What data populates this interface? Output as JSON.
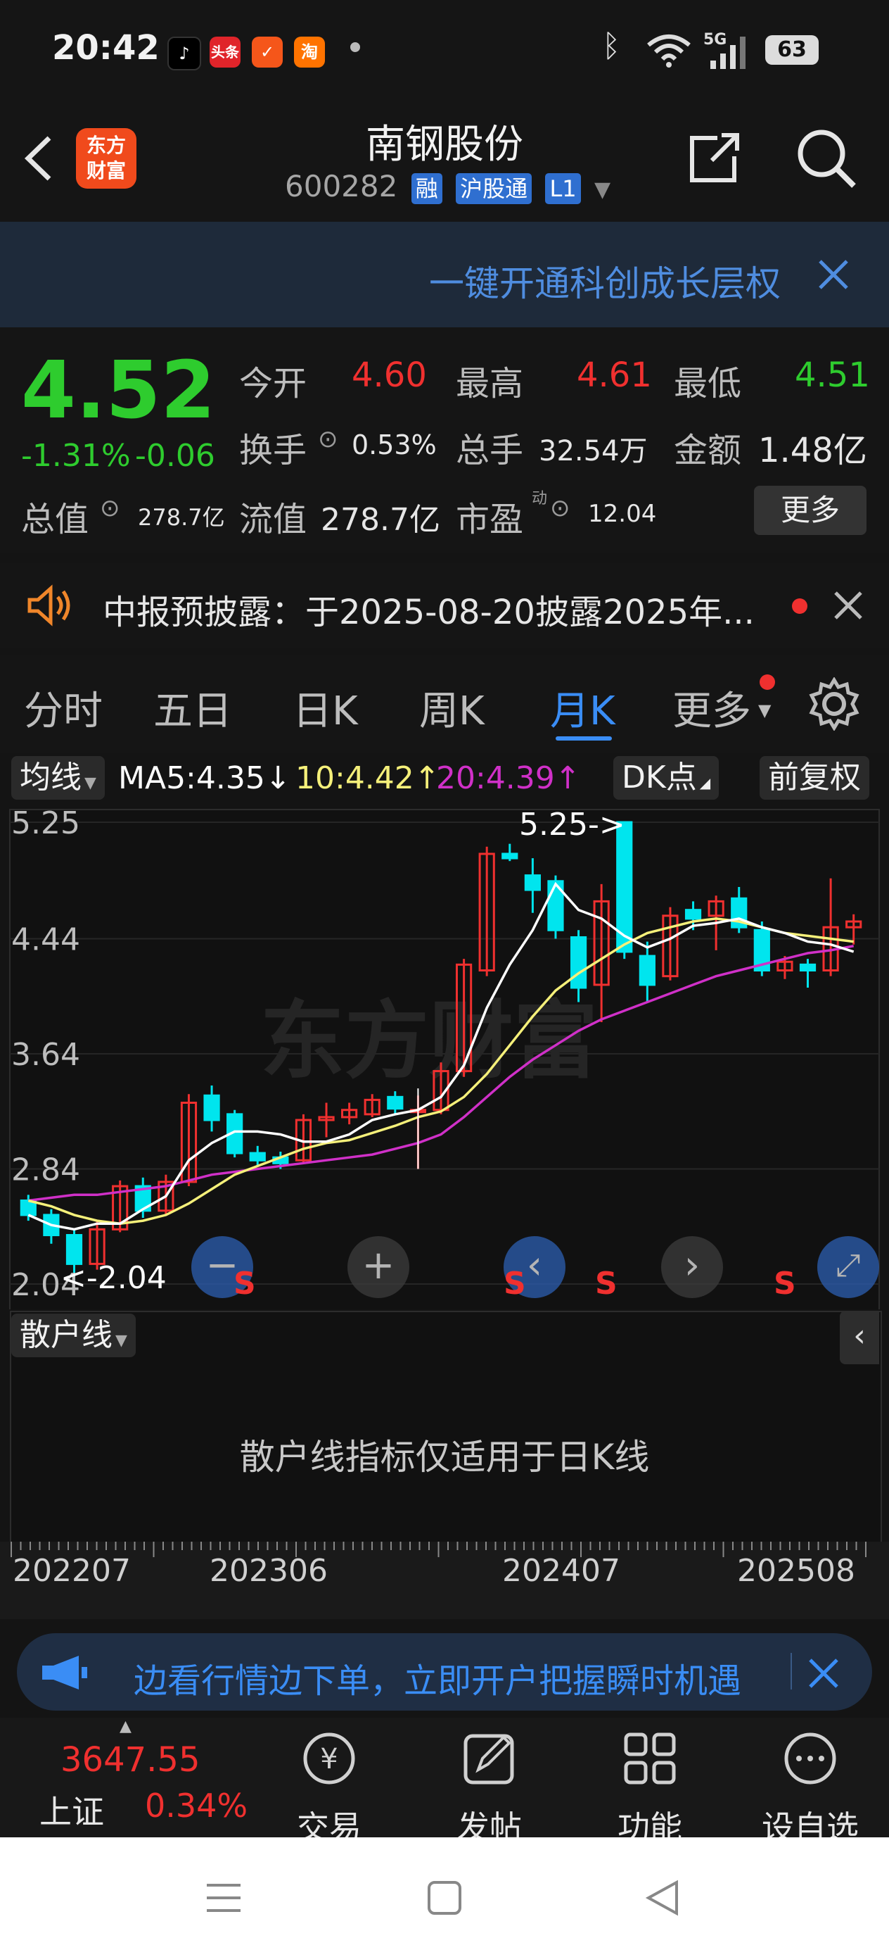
{
  "status_bar": {
    "time": "20:42",
    "battery": "63",
    "network": "5G",
    "app_icons": [
      "tiktok-icon",
      "toutiao-icon",
      "app-icon",
      "taobao-icon"
    ],
    "toutiao_label": "头条",
    "taobao_label": "淘"
  },
  "header": {
    "title": "南钢股份",
    "code": "600282",
    "tags": [
      "融",
      "沪股通",
      "L1"
    ],
    "logo_line1": "东方",
    "logo_line2": "财富"
  },
  "banner": {
    "text": "一键开通科创成长层权"
  },
  "quote": {
    "price": "4.52",
    "change_pct": "-1.31%",
    "change": "-0.06",
    "open_label": "今开",
    "open": "4.60",
    "high_label": "最高",
    "high": "4.61",
    "low_label": "最低",
    "low": "4.51",
    "turnover_label": "换手",
    "turnover": "0.53%",
    "volume_label": "总手",
    "volume": "32.54万",
    "amount_label": "金额",
    "amount": "1.48亿",
    "mktcap_label": "总值",
    "mktcap": "278.7亿",
    "float_label": "流值",
    "float": "278.7亿",
    "pe_label": "市盈",
    "pe_sup": "动",
    "pe": "12.04",
    "more_button": "更多"
  },
  "notice": {
    "text": "中报预披露：于2025-08-20披露2025年..."
  },
  "tabs": [
    "分时",
    "五日",
    "日K",
    "周K",
    "月K",
    "更多"
  ],
  "chart": {
    "ma_select": "均线",
    "ma5": "MA5:4.35↓",
    "ma10": "10:4.42↑",
    "ma20": "20:4.39↑",
    "dk_button": "DK点",
    "adjust_button": "前复权",
    "y_labels": [
      "5.25",
      "4.44",
      "3.64",
      "2.84",
      "2.04"
    ],
    "max_label": "5.25->",
    "min_label": "<-2.04",
    "signal_label": "S",
    "indicator_select": "散户线",
    "indicator_note": "散户线指标仅适用于日K线",
    "x_labels": [
      "202207",
      "202306",
      "202407",
      "202508"
    ],
    "colors": {
      "up": "#f0302f",
      "down": "#00e5ee",
      "ma5": "#ffffff",
      "ma10": "#f5f07a",
      "ma20": "#d030c8"
    }
  },
  "chart_data": {
    "type": "candlestick",
    "period": "monthly",
    "y_ticks": [
      5.25,
      4.44,
      3.64,
      2.84,
      2.04
    ],
    "ylim": [
      2.04,
      5.25
    ],
    "x_ticks": [
      "202207",
      "202306",
      "202407",
      "202508"
    ],
    "candles": [
      {
        "o": 2.62,
        "c": 2.52,
        "h": 2.66,
        "l": 2.48
      },
      {
        "o": 2.52,
        "c": 2.38,
        "h": 2.56,
        "l": 2.32
      },
      {
        "o": 2.38,
        "c": 2.18,
        "h": 2.42,
        "l": 2.04
      },
      {
        "o": 2.18,
        "c": 2.42,
        "h": 2.48,
        "l": 2.14
      },
      {
        "o": 2.42,
        "c": 2.72,
        "h": 2.76,
        "l": 2.4
      },
      {
        "o": 2.72,
        "c": 2.55,
        "h": 2.78,
        "l": 2.5
      },
      {
        "o": 2.55,
        "c": 2.75,
        "h": 2.8,
        "l": 2.52
      },
      {
        "o": 2.75,
        "c": 3.3,
        "h": 3.36,
        "l": 2.72
      },
      {
        "o": 3.35,
        "c": 3.18,
        "h": 3.42,
        "l": 3.1
      },
      {
        "o": 3.22,
        "c": 2.95,
        "h": 3.25,
        "l": 2.92
      },
      {
        "o": 2.95,
        "c": 2.9,
        "h": 3.0,
        "l": 2.86
      },
      {
        "o": 2.92,
        "c": 2.88,
        "h": 2.96,
        "l": 2.84
      },
      {
        "o": 2.9,
        "c": 3.18,
        "h": 3.22,
        "l": 2.88
      },
      {
        "o": 3.18,
        "c": 3.2,
        "h": 3.3,
        "l": 3.06
      },
      {
        "o": 3.2,
        "c": 3.25,
        "h": 3.3,
        "l": 3.15
      },
      {
        "o": 3.22,
        "c": 3.32,
        "h": 3.36,
        "l": 3.2
      },
      {
        "o": 3.34,
        "c": 3.26,
        "h": 3.38,
        "l": 3.22
      },
      {
        "o": 3.25,
        "c": 3.25,
        "h": 3.35,
        "l": 2.84
      },
      {
        "o": 3.25,
        "c": 3.52,
        "h": 3.58,
        "l": 3.22
      },
      {
        "o": 3.52,
        "c": 4.26,
        "h": 4.3,
        "l": 3.48
      },
      {
        "o": 4.22,
        "c": 5.03,
        "h": 5.08,
        "l": 4.18
      },
      {
        "o": 5.03,
        "c": 5.0,
        "h": 5.1,
        "l": 4.98
      },
      {
        "o": 4.88,
        "c": 4.78,
        "h": 5.0,
        "l": 4.62
      },
      {
        "o": 4.84,
        "c": 4.5,
        "h": 4.88,
        "l": 4.44
      },
      {
        "o": 4.45,
        "c": 4.1,
        "h": 4.5,
        "l": 4.0
      },
      {
        "o": 4.12,
        "c": 4.7,
        "h": 4.82,
        "l": 3.86
      },
      {
        "o": 5.25,
        "c": 4.35,
        "h": 5.25,
        "l": 4.3
      },
      {
        "o": 4.32,
        "c": 4.12,
        "h": 4.42,
        "l": 4.0
      },
      {
        "o": 4.18,
        "c": 4.6,
        "h": 4.66,
        "l": 4.15
      },
      {
        "o": 4.64,
        "c": 4.58,
        "h": 4.7,
        "l": 4.5
      },
      {
        "o": 4.6,
        "c": 4.7,
        "h": 4.74,
        "l": 4.36
      },
      {
        "o": 4.72,
        "c": 4.52,
        "h": 4.8,
        "l": 4.48
      },
      {
        "o": 4.5,
        "c": 4.22,
        "h": 4.56,
        "l": 4.18
      },
      {
        "o": 4.22,
        "c": 4.28,
        "h": 4.32,
        "l": 4.16
      },
      {
        "o": 4.26,
        "c": 4.22,
        "h": 4.3,
        "l": 4.1
      },
      {
        "o": 4.22,
        "c": 4.52,
        "h": 4.86,
        "l": 4.18
      },
      {
        "o": 4.52,
        "c": 4.56,
        "h": 4.61,
        "l": 4.4
      }
    ],
    "ma5": [
      2.52,
      2.45,
      2.42,
      2.46,
      2.46,
      2.56,
      2.65,
      2.9,
      3.02,
      3.1,
      3.1,
      3.08,
      3.03,
      3.03,
      3.08,
      3.18,
      3.22,
      3.25,
      3.34,
      3.56,
      3.96,
      4.26,
      4.5,
      4.82,
      4.64,
      4.58,
      4.46,
      4.38,
      4.44,
      4.53,
      4.55,
      4.58,
      4.52,
      4.48,
      4.42,
      4.4,
      4.35
    ],
    "ma10": [
      2.62,
      2.58,
      2.52,
      2.48,
      2.46,
      2.48,
      2.52,
      2.6,
      2.7,
      2.8,
      2.86,
      2.92,
      2.98,
      3.02,
      3.04,
      3.09,
      3.14,
      3.2,
      3.24,
      3.34,
      3.5,
      3.7,
      3.9,
      4.08,
      4.2,
      4.3,
      4.4,
      4.48,
      4.52,
      4.56,
      4.58,
      4.56,
      4.52,
      4.48,
      4.46,
      4.44,
      4.42
    ],
    "ma20": [
      2.62,
      2.64,
      2.66,
      2.66,
      2.68,
      2.7,
      2.72,
      2.76,
      2.8,
      2.82,
      2.84,
      2.86,
      2.88,
      2.9,
      2.92,
      2.94,
      2.98,
      3.02,
      3.08,
      3.2,
      3.34,
      3.48,
      3.6,
      3.7,
      3.8,
      3.88,
      3.94,
      4.0,
      4.06,
      4.12,
      4.18,
      4.22,
      4.26,
      4.3,
      4.34,
      4.36,
      4.39
    ]
  },
  "ad": {
    "text": "边看行情边下单，立即开户把握瞬时机遇"
  },
  "bottom_nav": {
    "index_value": "3647.55",
    "index_name": "上证",
    "index_change": "0.34%",
    "items": [
      "交易",
      "发帖",
      "功能",
      "设自选"
    ]
  }
}
